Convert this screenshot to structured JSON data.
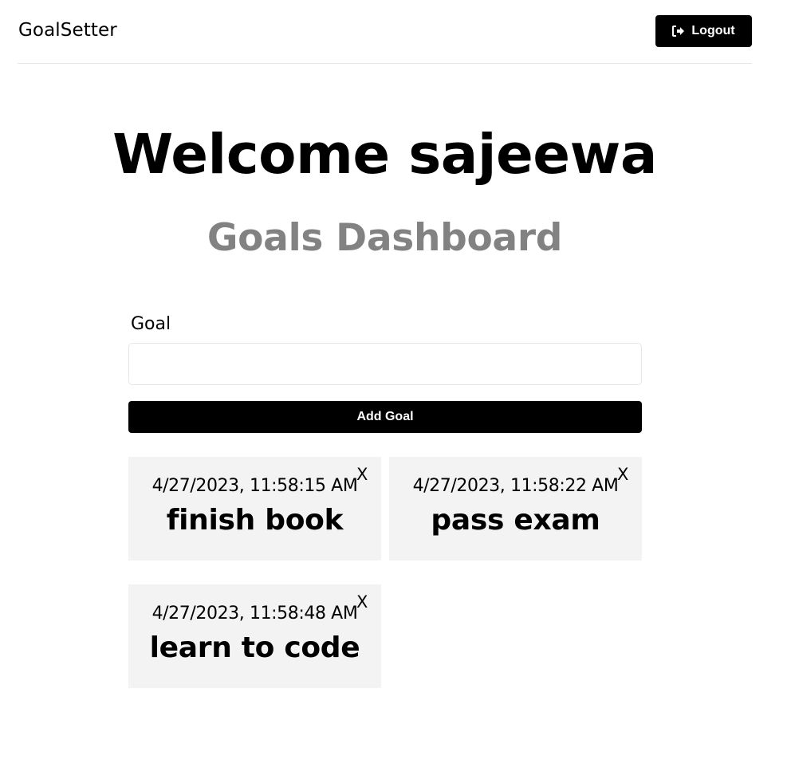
{
  "header": {
    "brand": "GoalSetter",
    "logout_label": "Logout",
    "logout_icon": "sign-out-icon"
  },
  "main": {
    "welcome": "Welcome sajeewa",
    "subtitle": "Goals Dashboard"
  },
  "form": {
    "goal_label": "Goal",
    "goal_value": "",
    "add_button_label": "Add Goal"
  },
  "goals": [
    {
      "date": "4/27/2023, 11:58:15 AM",
      "text": "finish book",
      "close": "X"
    },
    {
      "date": "4/27/2023, 11:58:22 AM",
      "text": "pass exam",
      "close": "X"
    },
    {
      "date": "4/27/2023, 11:58:48 AM",
      "text": "learn to code",
      "close": "X"
    }
  ],
  "colors": {
    "primary": "#000000",
    "subtitle": "#828282",
    "card_bg": "#f3f3f3",
    "border": "#e6e6e6"
  }
}
